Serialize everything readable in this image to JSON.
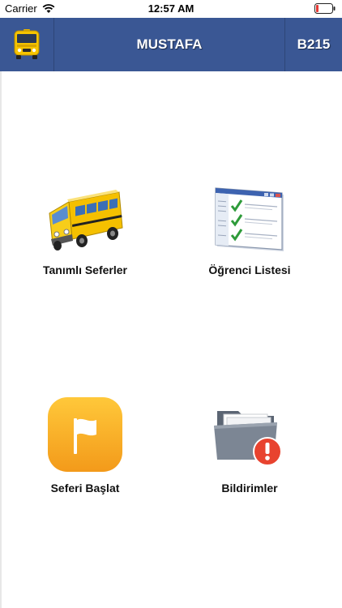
{
  "status_bar": {
    "carrier": "Carrier",
    "time": "12:57 AM",
    "battery_color": "#e53935"
  },
  "header": {
    "title": "MUSTAFA",
    "code": "B215",
    "background": "#3a5794",
    "left_icon": "school-bus-icon"
  },
  "menu": {
    "items": [
      {
        "label": "Tanımlı Seferler",
        "icon": "school-bus-icon"
      },
      {
        "label": "Öğrenci Listesi",
        "icon": "checklist-window-icon"
      },
      {
        "label": "Seferi Başlat",
        "icon": "flag-app-icon"
      },
      {
        "label": "Bildirimler",
        "icon": "folder-alert-icon"
      }
    ]
  }
}
